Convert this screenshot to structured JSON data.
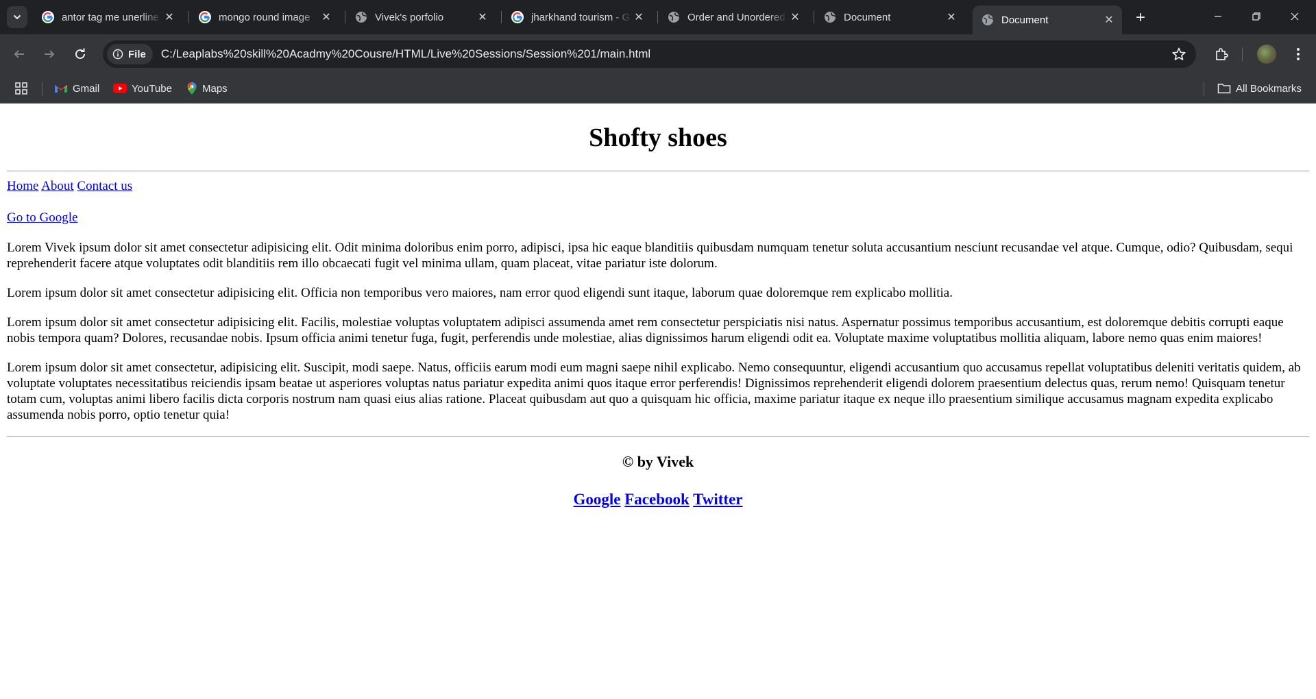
{
  "browser": {
    "tabs": [
      {
        "title": "antor tag me unerline",
        "icon": "google-icon"
      },
      {
        "title": "mongo round image",
        "icon": "google-icon"
      },
      {
        "title": "Vivek's porfolio",
        "icon": "globe-icon"
      },
      {
        "title": "jharkhand tourism - G",
        "icon": "google-icon"
      },
      {
        "title": "Order and Unordered",
        "icon": "globe-icon"
      },
      {
        "title": "Document",
        "icon": "globe-icon"
      },
      {
        "title": "Document",
        "icon": "globe-icon",
        "active": true
      }
    ],
    "address": {
      "chip_label": "File",
      "url": "C:/Leaplabs%20skill%20Acadmy%20Cousre/HTML/Live%20Sessions/Session%201/main.html"
    },
    "bookmarks": [
      {
        "label": "Gmail",
        "icon": "gmail-icon"
      },
      {
        "label": "YouTube",
        "icon": "youtube-icon"
      },
      {
        "label": "Maps",
        "icon": "maps-icon"
      }
    ],
    "all_bookmarks_label": "All Bookmarks"
  },
  "page": {
    "title": "Shofty shoes",
    "nav": [
      {
        "label": "Home"
      },
      {
        "label": "About"
      },
      {
        "label": "Contact us"
      }
    ],
    "google_link": "Go to Google",
    "paragraphs": [
      "Lorem Vivek ipsum dolor sit amet consectetur adipisicing elit. Odit minima doloribus enim porro, adipisci, ipsa hic eaque blanditiis quibusdam numquam tenetur soluta accusantium nesciunt recusandae vel atque. Cumque, odio? Quibusdam, sequi reprehenderit facere atque voluptates odit blanditiis rem illo obcaecati fugit vel minima ullam, quam placeat, vitae pariatur iste dolorum.",
      "Lorem ipsum dolor sit amet consectetur adipisicing elit. Officia non temporibus vero maiores, nam error quod eligendi sunt itaque, laborum quae doloremque rem explicabo mollitia.",
      "Lorem ipsum dolor sit amet consectetur adipisicing elit. Facilis, molestiae voluptas voluptatem adipisci assumenda amet rem consectetur perspiciatis nisi natus. Aspernatur possimus temporibus accusantium, est doloremque debitis corrupti eaque nobis tempora quam? Dolores, recusandae nobis. Ipsum officia animi tenetur fuga, fugit, perferendis unde molestiae, alias dignissimos harum eligendi odit ea. Voluptate maxime voluptatibus mollitia aliquam, labore nemo quas enim maiores!",
      "Lorem ipsum dolor sit amet consectetur, adipisicing elit. Suscipit, modi saepe. Natus, officiis earum modi eum magni saepe nihil explicabo. Nemo consequuntur, eligendi accusantium quo accusamus repellat voluptatibus deleniti veritatis quidem, ab voluptate voluptates necessitatibus reiciendis ipsam beatae ut asperiores voluptas natus pariatur expedita animi quos itaque error perferendis! Dignissimos reprehenderit eligendi dolorem praesentium delectus quas, rerum nemo! Quisquam tenetur totam cum, voluptas animi libero facilis dicta corporis nostrum nam quasi eius alias ratione. Placeat quibusdam aut quo a quisquam hic officia, maxime pariatur itaque ex neque illo praesentium similique accusamus magnam expedita explicabo assumenda nobis porro, optio tenetur quia!"
    ],
    "footer": {
      "copyright": "© by Vivek",
      "social": [
        {
          "label": "Google"
        },
        {
          "label": "Facebook"
        },
        {
          "label": "Twitter"
        }
      ]
    },
    "colors": {
      "link": "#0000ee",
      "chrome_dark": "#202124",
      "chrome_toolbar": "#35363a"
    }
  }
}
